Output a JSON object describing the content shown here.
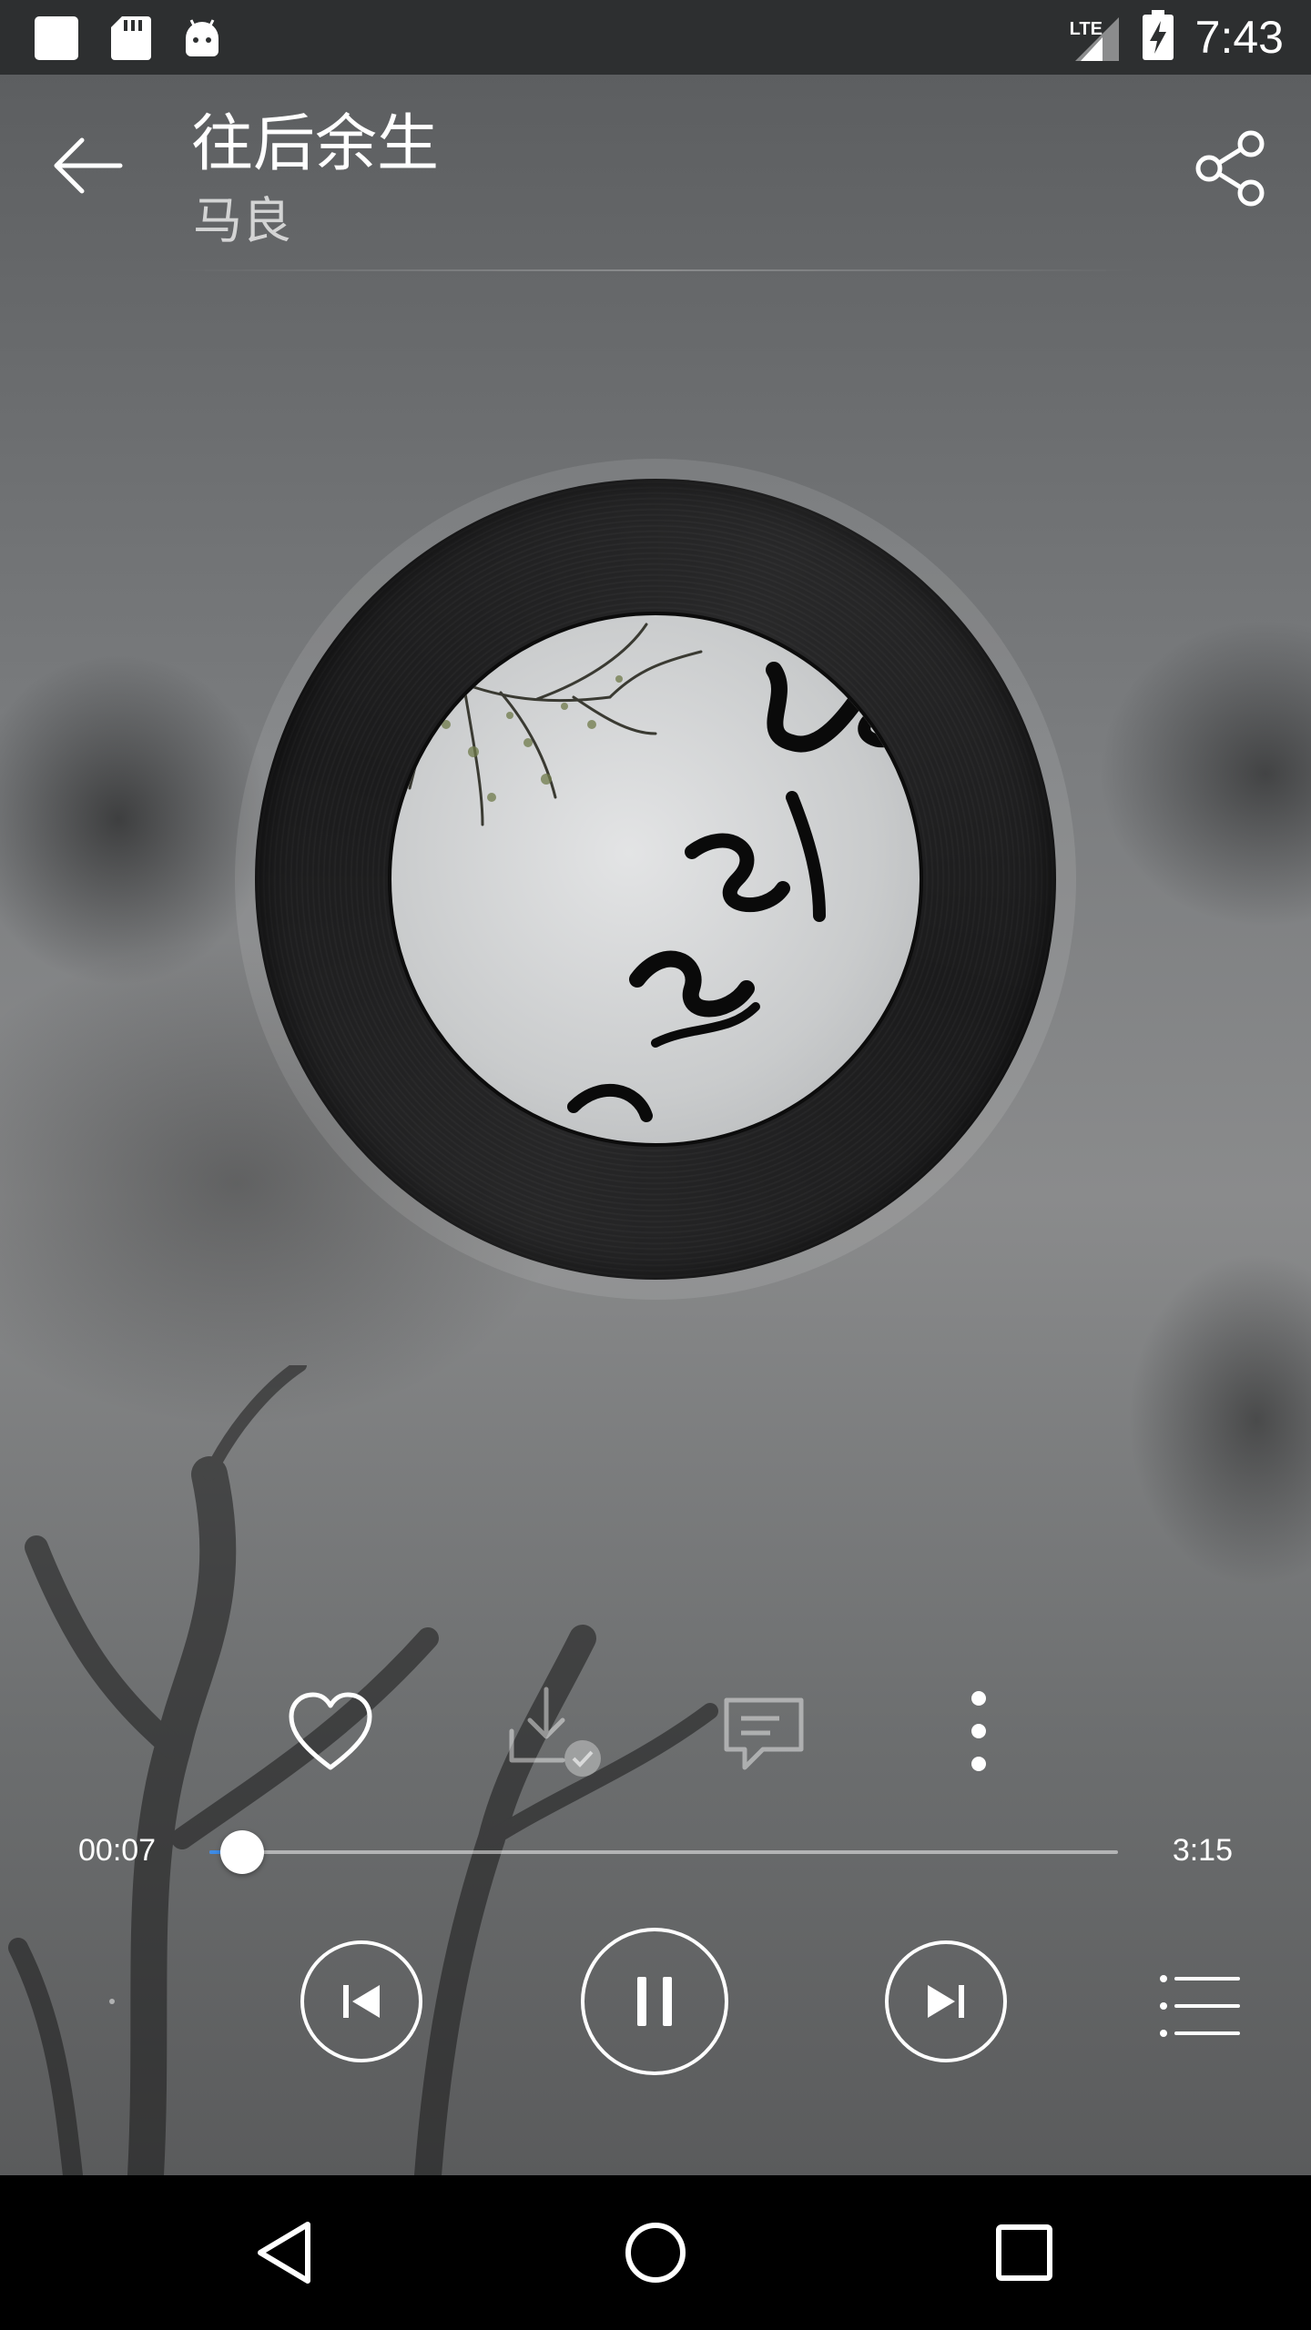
{
  "status_bar": {
    "time": "7:43",
    "network": "LTE",
    "icons": [
      "notification-square-icon",
      "sd-card-icon",
      "android-icon",
      "signal-icon",
      "battery-charging-icon"
    ]
  },
  "header": {
    "title": "往后余生",
    "artist": "马良",
    "icons": [
      "back-arrow-icon",
      "share-icon"
    ]
  },
  "actions": {
    "icons": [
      "heart-icon",
      "download-icon",
      "comment-icon",
      "more-vertical-icon"
    ]
  },
  "progress": {
    "current": "00:07",
    "total": "3:15",
    "fraction": 0.036
  },
  "transport": {
    "icons": [
      "previous-icon",
      "pause-icon",
      "next-icon",
      "playlist-icon"
    ]
  },
  "nav_bar": {
    "icons": [
      "nav-back-icon",
      "nav-home-icon",
      "nav-recents-icon"
    ]
  },
  "colors": {
    "accent": "#3d8be6",
    "status_bar": "#2d2f30",
    "nav_bar": "#000000"
  }
}
